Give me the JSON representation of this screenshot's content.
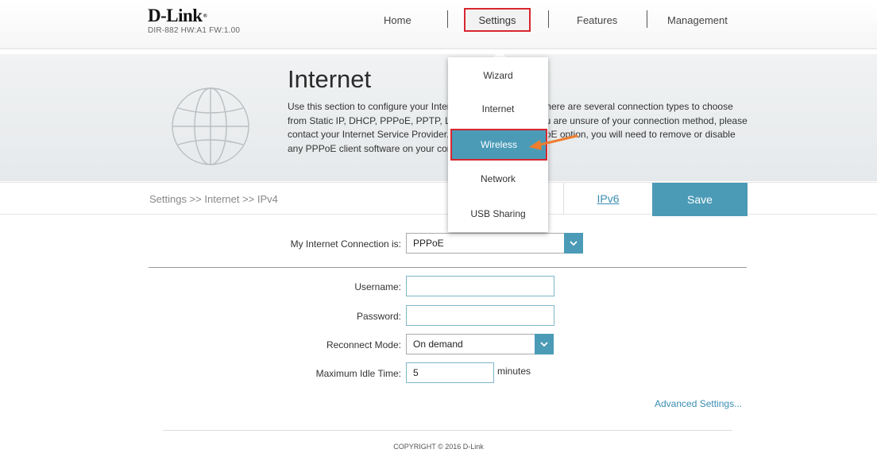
{
  "header": {
    "brand": "D-Link",
    "brand_mark": "®",
    "model": "DIR-882 HW:A1 FW:1.00",
    "nav": {
      "home": "Home",
      "settings": "Settings",
      "features": "Features",
      "management": "Management"
    }
  },
  "hero": {
    "title": "Internet",
    "description": "Use this section to configure your Internet Connection type. There are several connection types to choose from Static IP, DHCP, PPPoE, PPTP, L2TP, and DS-Lite. If you are unsure of your connection method, please contact your Internet Service Provider. Note: If using the PPPoE option, you will need to remove or disable any PPPoE client software on your computers.",
    "icon": "globe-icon"
  },
  "breadcrumb": "Settings >> Internet >> IPv4",
  "actions": {
    "ipv6": "IPv6",
    "save": "Save"
  },
  "form": {
    "connection_label": "My Internet Connection is:",
    "connection_value": "PPPoE",
    "username_label": "Username:",
    "username_value": "",
    "password_label": "Password:",
    "password_value": "",
    "reconnect_label": "Reconnect Mode:",
    "reconnect_value": "On demand",
    "idle_label": "Maximum Idle Time:",
    "idle_value": "5",
    "idle_units": "minutes",
    "advanced": "Advanced Settings..."
  },
  "dropdown": {
    "items": [
      "Wizard",
      "Internet",
      "Wireless",
      "Network",
      "USB Sharing"
    ],
    "highlighted": "Wireless"
  },
  "footer": {
    "copyright": "COPYRIGHT © 2016 D-Link"
  },
  "colors": {
    "accent": "#4b9bb7",
    "highlight_border": "#d8262e",
    "annotation_arrow": "#ef7d2d",
    "link": "#3a8db3"
  }
}
